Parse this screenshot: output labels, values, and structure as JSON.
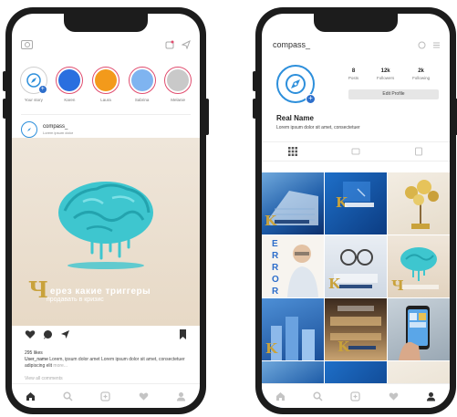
{
  "feed": {
    "stories": [
      {
        "label": "Your story",
        "color": "#ffffff",
        "own": true
      },
      {
        "label": "Karen",
        "color": "#2a6fdf"
      },
      {
        "label": "Laura",
        "color": "#f39a1b"
      },
      {
        "label": "Sabrina",
        "color": "#7fb4f0"
      },
      {
        "label": "Melanie",
        "color": "#c9c9c9"
      }
    ],
    "post": {
      "account": "compass_",
      "subtitle": "Lorem ipsum dolor",
      "caption_letter": "Ч",
      "caption_line1": "ерез какие триггеры",
      "caption_line2": "продавать в кризис",
      "likes": "295 likes",
      "caption_user": "User_name",
      "caption_text": "Lorem, ipsum dolor amet Lorem ipsum dolor sit amet, consectetuer adipiscing elit",
      "more": "more...",
      "view_all": "View all comments"
    }
  },
  "profile": {
    "username": "compass_",
    "stats": [
      {
        "num": "8",
        "label": "Posts"
      },
      {
        "num": "12k",
        "label": "Followers"
      },
      {
        "num": "2k",
        "label": "Following"
      }
    ],
    "edit_label": "Edit Profile",
    "name": "Real Name",
    "bio": "Lorem ipsum dolor sit amet, consectetuer",
    "error_letters": [
      "E",
      "R",
      "R",
      "O",
      "R"
    ]
  },
  "colors": {
    "accent": "#2d8fdb",
    "brain": "#3ec6cf",
    "gold": "#c9a23b"
  }
}
